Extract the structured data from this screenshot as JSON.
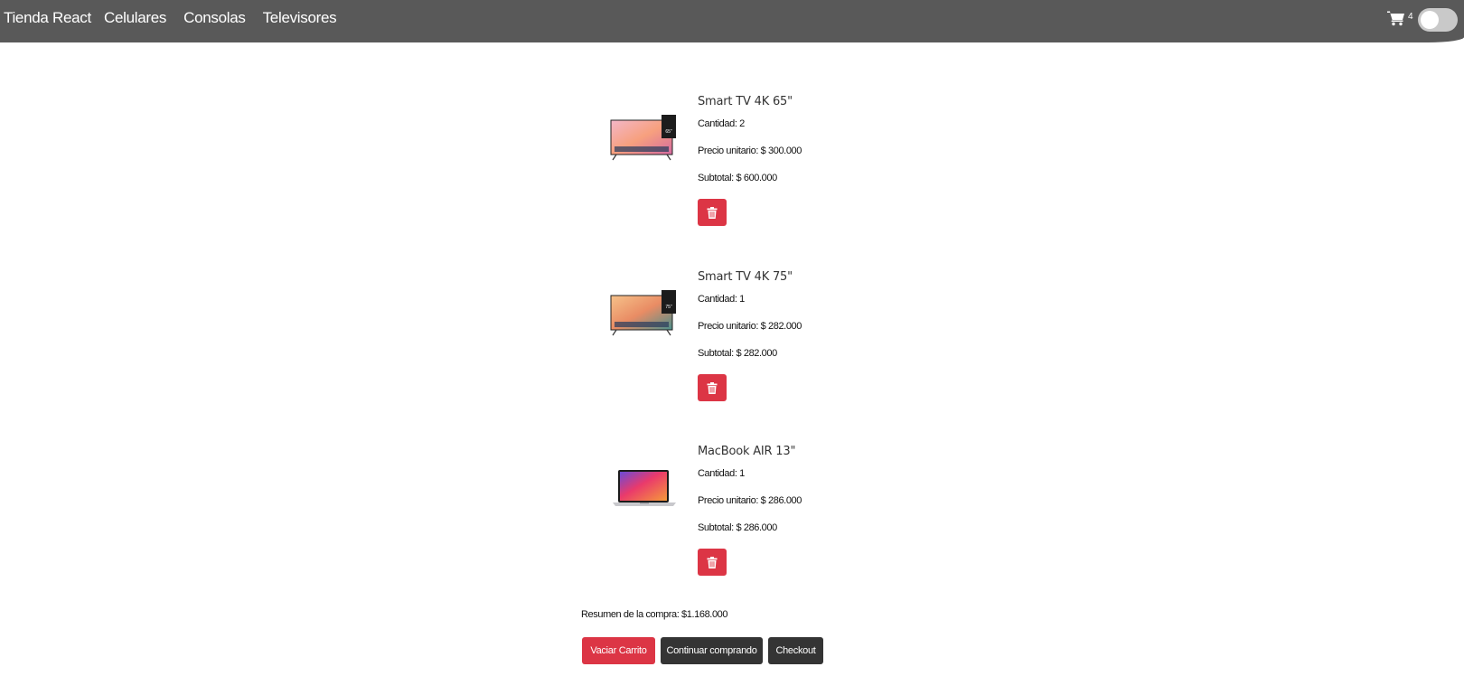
{
  "navbar": {
    "brand": "Tienda React",
    "links": [
      {
        "label": "Celulares"
      },
      {
        "label": "Consolas"
      },
      {
        "label": "Televisores"
      }
    ],
    "cart_count": "4",
    "theme_toggle_on": false
  },
  "cart": {
    "items": [
      {
        "title": "Smart TV 4K 65\"",
        "qty_label": "Cantidad:",
        "qty": "2",
        "unit_label": "Precio unitario:",
        "unit_price": "$ 300.000",
        "subtotal_label": "Subtotal:",
        "subtotal": "$ 600.000",
        "image": "tv-image"
      },
      {
        "title": "Smart TV 4K 75\"",
        "qty_label": "Cantidad:",
        "qty": "1",
        "unit_label": "Precio unitario:",
        "unit_price": "$ 282.000",
        "subtotal_label": "Subtotal:",
        "subtotal": "$ 282.000",
        "image": "tv-image"
      },
      {
        "title": "MacBook AIR 13\"",
        "qty_label": "Cantidad:",
        "qty": "1",
        "unit_label": "Precio unitario:",
        "unit_price": "$ 286.000",
        "subtotal_label": "Subtotal:",
        "subtotal": "$ 286.000",
        "image": "laptop-image"
      }
    ]
  },
  "summary": {
    "label": "Resumen de la compra:",
    "total": "$1.168.000"
  },
  "actions": {
    "empty_cart": "Vaciar Carrito",
    "continue_shopping": "Continuar comprando",
    "checkout": "Checkout"
  },
  "colors": {
    "navbar": "#595959",
    "danger": "#dc3545",
    "dark_button": "#343434"
  }
}
